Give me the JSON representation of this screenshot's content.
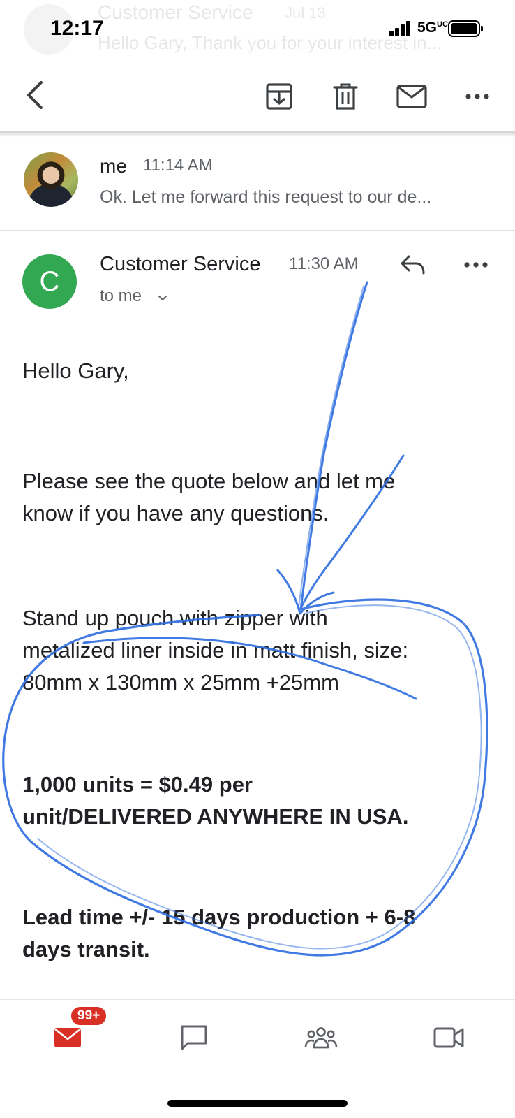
{
  "status_bar": {
    "time": "12:17",
    "network": "5G",
    "network_superscript": "UC"
  },
  "ghost_header": {
    "sender": "Customer Service",
    "date": "Jul 13",
    "snippet": "Hello Gary, Thank you for your interest in..."
  },
  "toolbar": {
    "icons": [
      "back-arrow-icon",
      "archive-icon",
      "trash-icon",
      "mail-unread-icon",
      "more-horizontal-icon"
    ]
  },
  "collapsed_message": {
    "sender": "me",
    "time": "11:14 AM",
    "snippet": "Ok. Let me forward this request to our de..."
  },
  "expanded_message": {
    "avatar_letter": "C",
    "sender": "Customer Service",
    "time": "11:30 AM",
    "recipient": "to me",
    "body": {
      "greeting": "Hello Gary,",
      "intro_line1": "Please see the quote below and let me",
      "intro_line2": "know if you have any questions.",
      "product_line1": "Stand up pouch with zipper with",
      "product_line2": "metalized liner inside in matt finish, size:",
      "product_line3": "80mm x 130mm x 25mm +25mm",
      "price_line1": "1,000 units = $0.49 per",
      "price_line2": "unit/DELIVERED ANYWHERE IN USA.",
      "lead_line1": "Lead time +/- 15 days production + 6-8",
      "lead_line2": "days transit."
    }
  },
  "bottom_nav": {
    "mail_badge": "99+",
    "icons": [
      "mail-icon",
      "chat-icon",
      "rooms-icon",
      "meet-video-icon"
    ]
  },
  "colors": {
    "accent_red": "#d93025",
    "avatar_green": "#33a853",
    "annotation_blue": "#2f6fe0",
    "secondary_text": "#5f6368"
  }
}
